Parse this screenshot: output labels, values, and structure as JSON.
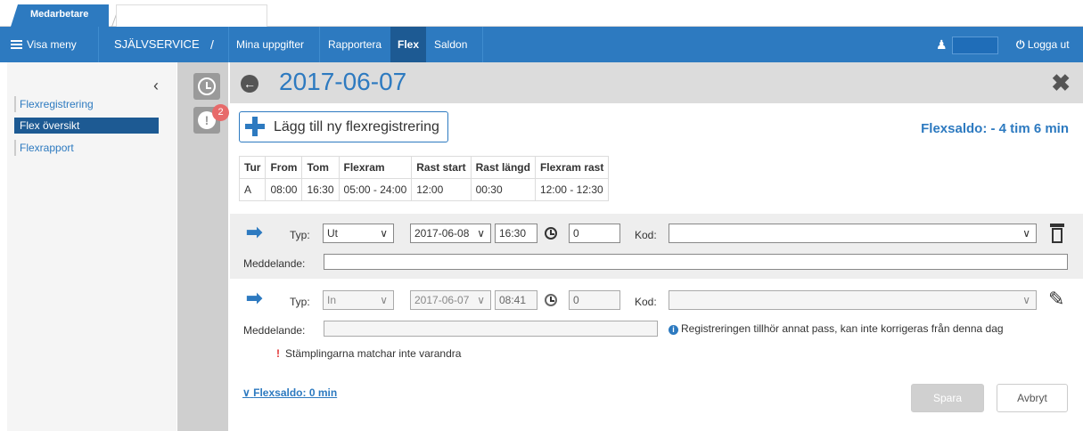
{
  "tabs": {
    "active_label": "Medarbetare"
  },
  "navbar": {
    "menu_label": "Visa meny",
    "section_label": "SJÄLVSERVICE",
    "breadcrumb_sep": "/",
    "items": [
      {
        "label": "Mina uppgifter"
      },
      {
        "label": "Rapportera"
      },
      {
        "label": "Flex"
      },
      {
        "label": "Saldon"
      }
    ],
    "active_item": "Flex",
    "logout_label": "Logga ut"
  },
  "sidebar": {
    "collapse_glyph": "‹",
    "items": [
      {
        "label": "Flexregistrering"
      },
      {
        "label": "Flex översikt"
      },
      {
        "label": "Flexrapport"
      }
    ],
    "active_item": "Flex översikt"
  },
  "rail": {
    "alert_count": "2"
  },
  "main": {
    "date": "2017-06-07",
    "add_button_label": "Lägg till ny flexregistrering",
    "flexsaldo": "Flexsaldo: - 4 tim 6 min"
  },
  "schedule": {
    "headers": [
      "Tur",
      "From",
      "Tom",
      "Flexram",
      "Rast start",
      "Rast längd",
      "Flexram rast"
    ],
    "rows": [
      [
        "A",
        "08:00",
        "16:30",
        "05:00 - 24:00",
        "12:00",
        "00:30",
        "12:00 - 12:30"
      ]
    ]
  },
  "registrations": [
    {
      "direction": "out",
      "typ_label": "Typ:",
      "typ_value": "Ut",
      "date": "2017-06-08",
      "time": "16:30",
      "number": "0",
      "kod_label": "Kod:",
      "kod_value": "",
      "message_label": "Meddelande:",
      "message_value": ""
    },
    {
      "direction": "in",
      "typ_label": "Typ:",
      "typ_value": "In",
      "date": "2017-06-07",
      "time": "08:41",
      "number": "0",
      "kod_label": "Kod:",
      "kod_value": "",
      "message_label": "Meddelande:",
      "message_value": "",
      "info": "Registreringen tillhör annat pass, kan inte korrigeras från denna dag"
    }
  ],
  "warning": "Stämplingarna matchar inte varandra",
  "footer": {
    "saldo_link": "Flexsaldo: 0 min",
    "save_label": "Spara",
    "cancel_label": "Avbryt"
  },
  "colors": {
    "primary": "#2d7ac0",
    "primary_dark": "#1d5a93",
    "badge": "#e76a6a",
    "warning": "#e23636"
  }
}
